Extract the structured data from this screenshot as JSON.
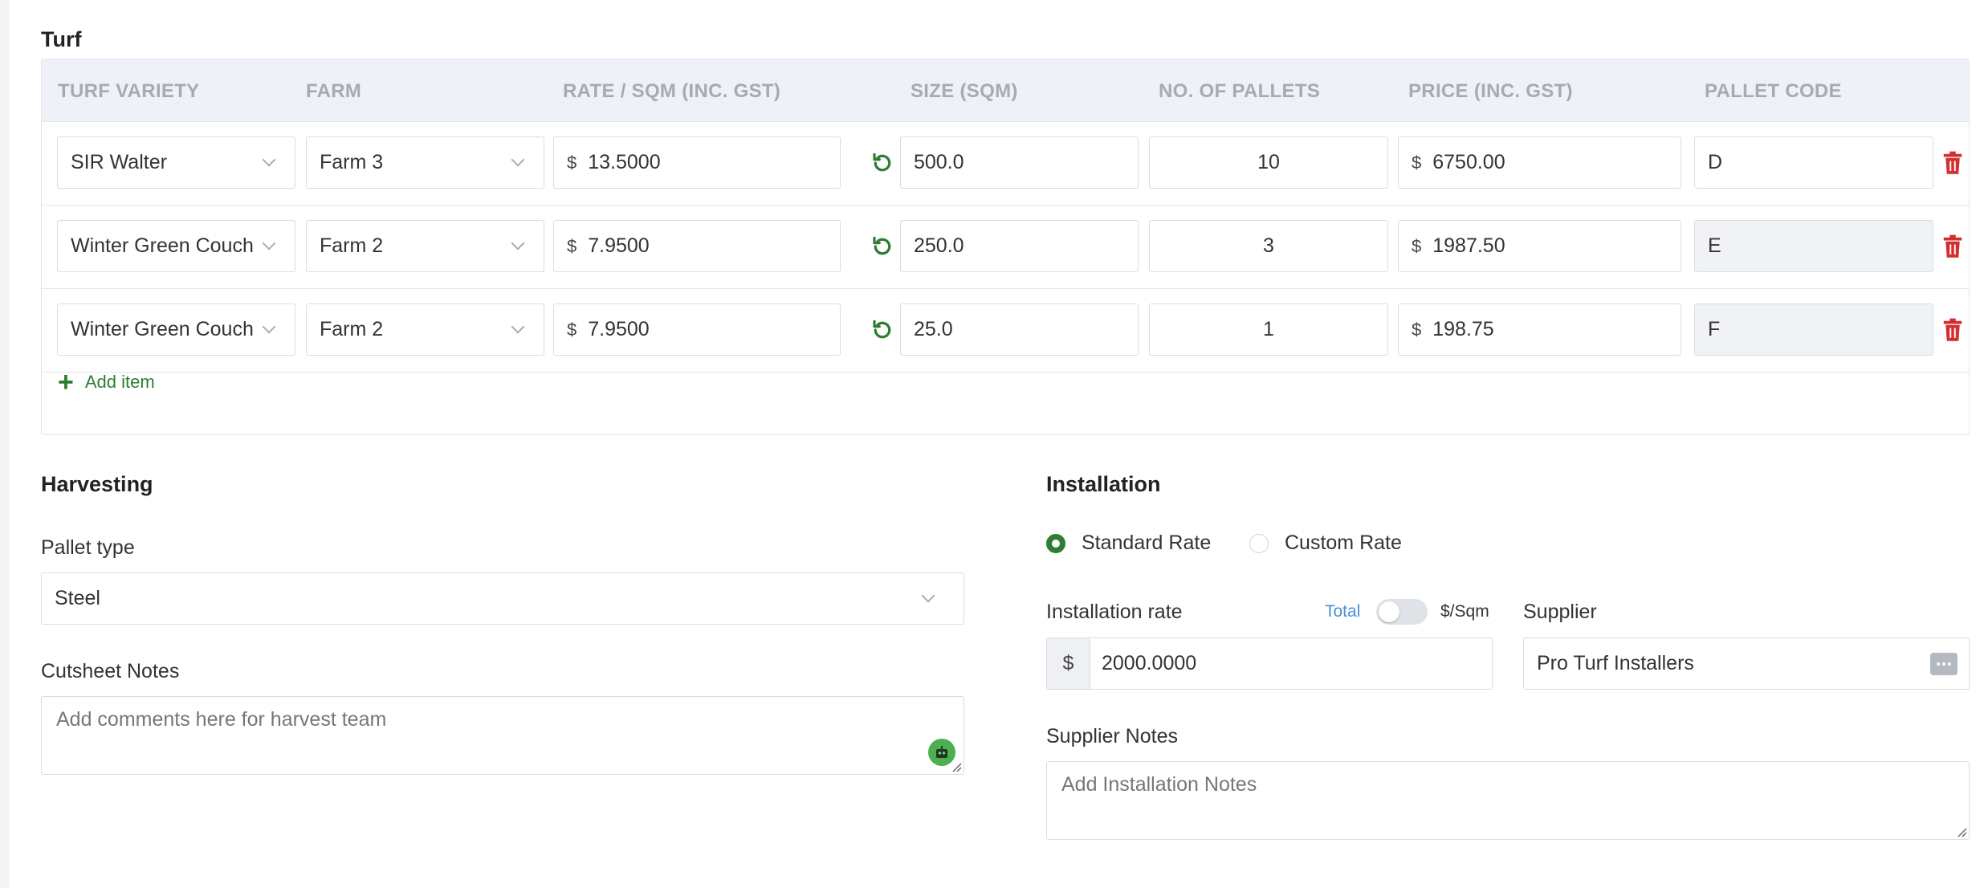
{
  "turf": {
    "title": "Turf",
    "columns": [
      "TURF VARIETY",
      "FARM",
      "RATE / SQM (INC. GST)",
      "SIZE (SQM)",
      "NO. OF PALLETS",
      "PRICE (INC. GST)",
      "PALLET CODE"
    ],
    "currency_symbol": "$",
    "rows": [
      {
        "variety": "SIR Walter",
        "farm": "Farm 3",
        "rate": "13.5000",
        "size": "500.0",
        "pallets": "10",
        "price": "6750.00",
        "code": "D"
      },
      {
        "variety": "Winter Green Couch",
        "farm": "Farm 2",
        "rate": "7.9500",
        "size": "250.0",
        "pallets": "3",
        "price": "1987.50",
        "code": "E"
      },
      {
        "variety": "Winter Green Couch",
        "farm": "Farm 2",
        "rate": "7.9500",
        "size": "25.0",
        "pallets": "1",
        "price": "198.75",
        "code": "F"
      }
    ],
    "add_item_label": "Add item"
  },
  "harvesting": {
    "title": "Harvesting",
    "pallet_type_label": "Pallet type",
    "pallet_type_value": "Steel",
    "cutsheet_label": "Cutsheet Notes",
    "cutsheet_placeholder": "Add comments here for harvest team"
  },
  "installation": {
    "title": "Installation",
    "standard_rate_label": "Standard Rate",
    "custom_rate_label": "Custom Rate",
    "selected_rate": "Standard Rate",
    "rate_label": "Installation rate",
    "toggle_left_label": "Total",
    "toggle_right_label": "$/Sqm",
    "rate_currency": "$",
    "rate_value": "2000.0000",
    "supplier_label": "Supplier",
    "supplier_value": "Pro Turf Installers",
    "supplier_notes_label": "Supplier Notes",
    "supplier_notes_placeholder": "Add Installation Notes"
  },
  "colors": {
    "accent_green": "#2e7d32",
    "delete_red": "#d32f2f",
    "link_blue": "#4a90d9"
  }
}
